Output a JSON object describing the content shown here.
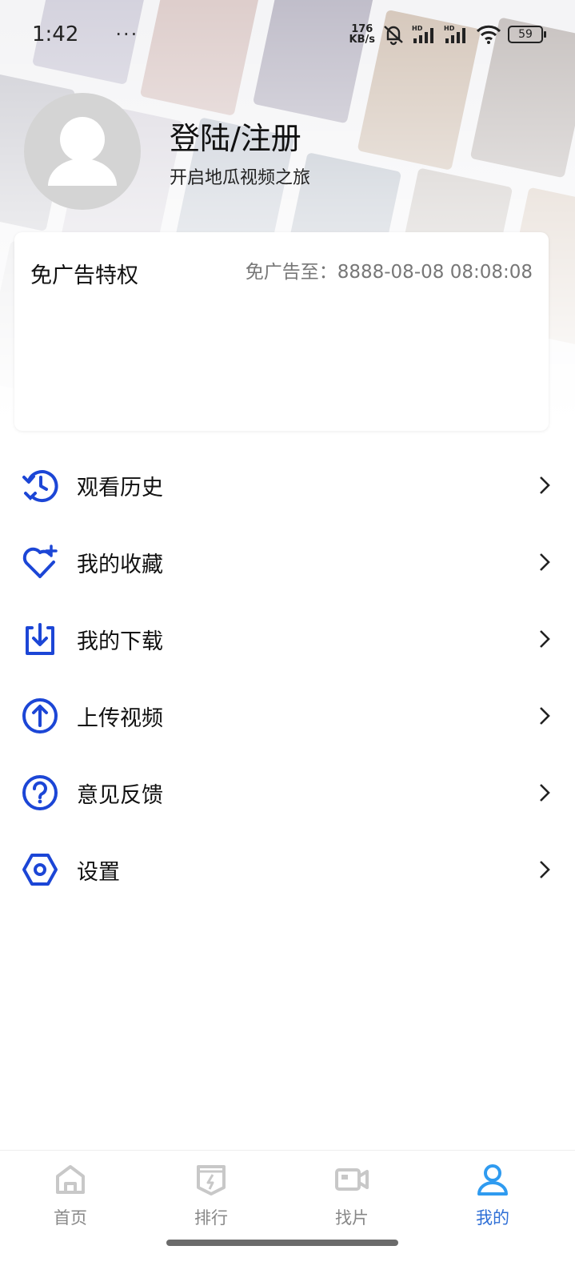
{
  "status_bar": {
    "time": "1:42",
    "dots": "···",
    "speed_value": "176",
    "speed_unit": "KB/s",
    "battery": "59"
  },
  "profile": {
    "title": "登陆/注册",
    "subtitle": "开启地瓜视频之旅"
  },
  "ad_card": {
    "title": "免广告特权",
    "expiry": "免广告至：8888-08-08 08:08:08"
  },
  "menu": {
    "items": [
      {
        "label": "观看历史",
        "icon": "history-icon"
      },
      {
        "label": "我的收藏",
        "icon": "favorite-icon"
      },
      {
        "label": "我的下载",
        "icon": "download-icon"
      },
      {
        "label": "上传视频",
        "icon": "upload-icon"
      },
      {
        "label": "意见反馈",
        "icon": "feedback-icon"
      },
      {
        "label": "设置",
        "icon": "settings-icon"
      }
    ]
  },
  "nav": {
    "items": [
      {
        "label": "首页",
        "icon": "home-icon",
        "active": false
      },
      {
        "label": "排行",
        "icon": "ranking-icon",
        "active": false
      },
      {
        "label": "找片",
        "icon": "video-camera-icon",
        "active": false
      },
      {
        "label": "我的",
        "icon": "profile-icon",
        "active": true
      }
    ]
  },
  "colors": {
    "accent": "#1c46d6",
    "nav_active": "#2f6fd6",
    "nav_inactive": "#c8c8c8"
  }
}
